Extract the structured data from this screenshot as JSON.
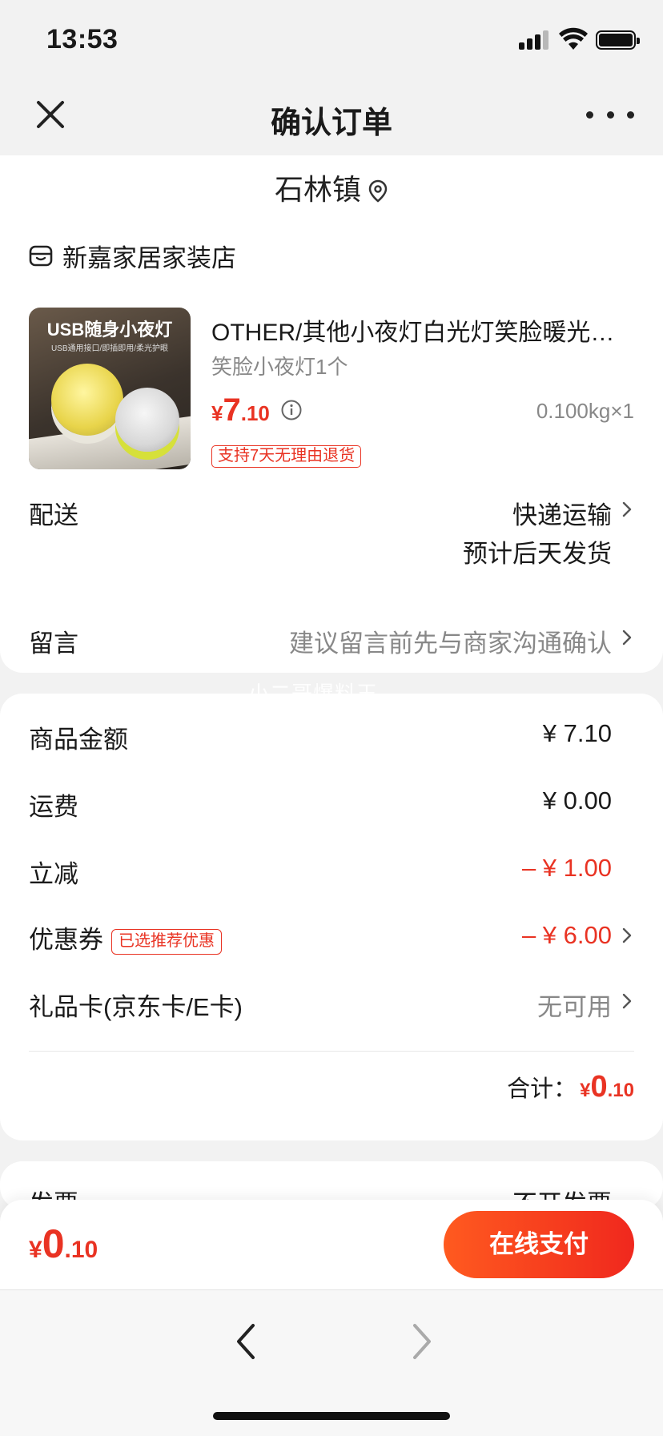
{
  "status_bar": {
    "time": "13:53"
  },
  "nav": {
    "title": "确认订单"
  },
  "address": {
    "location": "石林镇"
  },
  "store": {
    "name": "新嘉家居家装店"
  },
  "product": {
    "image_title": "USB随身小夜灯",
    "image_subtitle": "USB通用接口/即插即用/柔光护眼",
    "title": "OTHER/其他小夜灯白光灯笑脸暖光小夜灯",
    "spec": "笑脸小夜灯1个",
    "price_symbol": "¥",
    "price_int": "7",
    "price_dec": ".10",
    "weight_qty": "0.100kg×1",
    "return_policy": "支持7天无理由退货"
  },
  "delivery": {
    "label": "配送",
    "method": "快递运输",
    "eta": "预计后天发货"
  },
  "message": {
    "label": "留言",
    "placeholder": "建议留言前先与商家沟通确认"
  },
  "watermark": "小二哥爆料王",
  "summary": {
    "goods_label": "商品金额",
    "goods_value": "¥ 7.10",
    "shipping_label": "运费",
    "shipping_value": "¥ 0.00",
    "discount_label": "立减",
    "discount_value": "– ¥ 1.00",
    "coupon_label": "优惠券",
    "coupon_badge": "已选推荐优惠",
    "coupon_value": "– ¥ 6.00",
    "giftcard_label": "礼品卡(京东卡/E卡)",
    "giftcard_value": "无可用",
    "total_label": "合计：",
    "total_symbol": "¥",
    "total_int": "0",
    "total_dec": ".10"
  },
  "invoice": {
    "label": "发票",
    "value": "不开发票"
  },
  "pay_bar": {
    "symbol": "¥",
    "amount_int": "0",
    "amount_dec": ".10",
    "button_label": "在线支付"
  },
  "colors": {
    "accent_red": "#e93323",
    "pay_gradient_start": "#ff5a1f",
    "pay_gradient_end": "#f0281e"
  },
  "icons": [
    "close-icon",
    "more-icon",
    "location-pin-icon",
    "store-icon",
    "info-icon",
    "chevron-right-icon",
    "back-arrow-icon",
    "forward-arrow-icon"
  ]
}
